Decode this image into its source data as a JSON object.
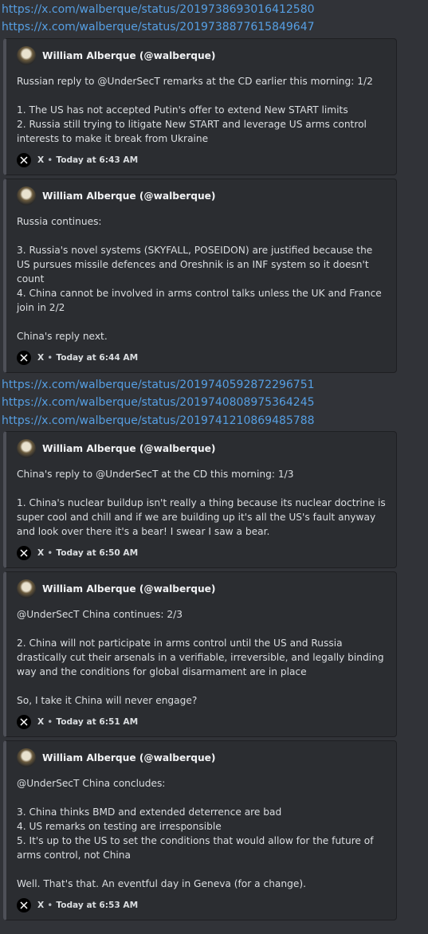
{
  "links_top": [
    "https://x.com/walberque/status/2019738693016412580",
    "https://x.com/walberque/status/2019738877615849647"
  ],
  "links_mid": [
    "https://x.com/walberque/status/2019740592872296751",
    "https://x.com/walberque/status/2019740808975364245",
    "https://x.com/walberque/status/2019741210869485788"
  ],
  "embeds": [
    {
      "author": "William Alberque (@walberque)",
      "text": "Russian reply to @UnderSecT remarks at the CD earlier this morning: 1/2\n\n1. The US has not accepted Putin's offer to extend New START limits\n2. Russia still trying to litigate New START and leverage US arms control interests to make it break from Ukraine",
      "source": "X",
      "time": "Today at 6:43 AM"
    },
    {
      "author": "William Alberque (@walberque)",
      "text": "Russia continues:\n\n3. Russia's novel systems (SKYFALL, POSEIDON) are justified because the US pursues missile defences and Oreshnik is an INF system so it doesn't count\n4. China cannot be involved in arms control talks unless the UK and France join in 2/2\n\nChina's reply next.",
      "source": "X",
      "time": "Today at 6:44 AM"
    },
    {
      "author": "William Alberque (@walberque)",
      "text": "China's reply to @UnderSecT at the CD this morning: 1/3\n\n1. China's nuclear buildup isn't really a thing because its nuclear doctrine is super cool and chill and if we are building up it's all the US's fault anyway and look over there it's a bear! I swear I saw a bear.",
      "source": "X",
      "time": "Today at 6:50 AM"
    },
    {
      "author": "William Alberque (@walberque)",
      "text": "@UnderSecT China continues: 2/3\n\n2. China will not participate in arms control until the US and Russia drastically cut their arsenals in a verifiable, irreversible, and legally binding way and the conditions for global disarmament are in place\n\nSo, I take it China will never engage?",
      "source": "X",
      "time": "Today at 6:51 AM"
    },
    {
      "author": "William Alberque (@walberque)",
      "text": "@UnderSecT China concludes:\n\n3. China thinks BMD and extended deterrence are bad\n4. US remarks on testing are irresponsible\n5. It's up to the US to set the conditions that would allow for the future of arms control, not China\n\nWell. That's that. An eventful day in Geneva (for a change).",
      "source": "X",
      "time": "Today at 6:53 AM"
    }
  ],
  "colors": {
    "background": "#313338",
    "embed": "#2b2d31",
    "link": "#569fe3"
  },
  "icons": {
    "x_logo": "x-logo-icon",
    "avatar": "author-avatar"
  }
}
